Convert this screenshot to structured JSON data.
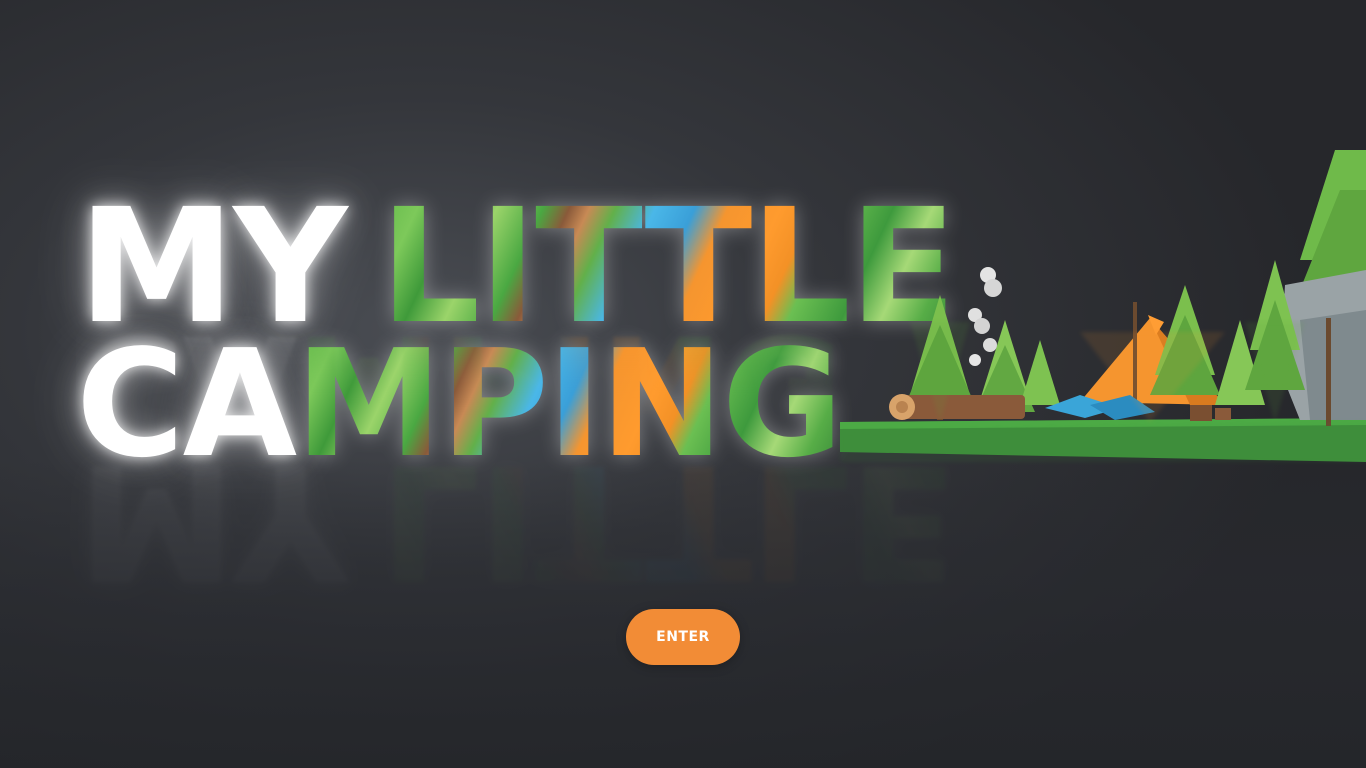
{
  "title": {
    "line1_a": "MY",
    "line1_b": "LITTLE",
    "line2_a": "CA",
    "line2_b": "MPING"
  },
  "enter_button": {
    "label": "ENTER"
  },
  "colors": {
    "background": "#2b2d31",
    "accent": "#f28c36",
    "grass": "#3e9a3d",
    "tent": "#f5952f",
    "text_glow": "#ffffff"
  },
  "scene": {
    "icons": [
      "tree-icon",
      "tent-icon",
      "log-icon",
      "campfire-smoke-icon",
      "rock-icon"
    ]
  }
}
